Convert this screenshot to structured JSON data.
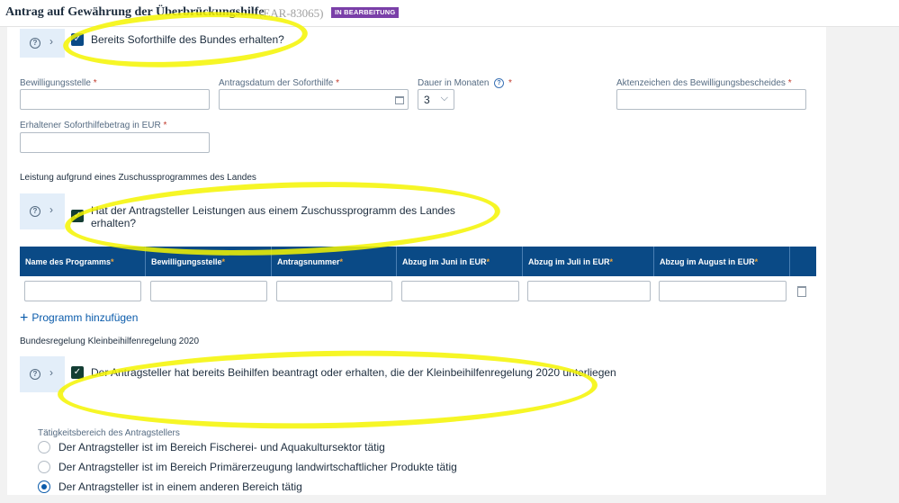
{
  "header": {
    "title": "Antrag auf Gewährung der Überbrückungshilfe",
    "id": "(EAR-83065)",
    "status_badge": "IN BEARBEITUNG"
  },
  "soforthilfe": {
    "checkbox_label": "Bereits Soforthilfe des Bundes erhalten?",
    "checked": true,
    "fields": {
      "bewilligungsstelle_label": "Bewilligungsstelle",
      "antragsdatum_label": "Antragsdatum der Soforthilfe",
      "dauer_label": "Dauer in Monaten",
      "dauer_value": "3",
      "aktenzeichen_label": "Aktenzeichen des Bewilligungsbescheides",
      "betrag_label": "Erhaltener Soforthilfebetrag in EUR",
      "required_marker": "*"
    }
  },
  "zuschuss": {
    "section_title": "Leistung aufgrund eines Zuschussprogrammes des Landes",
    "checkbox_label_line1": "Hat der Antragsteller Leistungen aus einem Zuschussprogramm des Landes",
    "checkbox_label_line2": "erhalten?",
    "checked": true,
    "table": {
      "columns": [
        "Name des Programms",
        "Bewilligungsstelle",
        "Antragsnummer",
        "Abzug im Juni in EUR",
        "Abzug im Juli in EUR",
        "Abzug im August in EUR"
      ],
      "required_marker": "*"
    },
    "add_row_label": "Programm hinzufügen"
  },
  "kleinbeihilfen": {
    "section_title": "Bundesregelung Kleinbeihilfenregelung 2020",
    "checkbox_label": "Der Antragsteller hat bereits Beihilfen beantragt oder erhalten, die der Kleinbeihilfenregelung 2020 unterliegen",
    "checked": true,
    "taetigkeit_label": "Tätigkeitsbereich des Antragstellers",
    "options": [
      "Der Antragsteller ist im Bereich Fischerei- und Aquakultursektor tätig",
      "Der Antragsteller ist im Bereich Primärerzeugung landwirtschaftlicher Produkte tätig",
      "Der Antragsteller ist in einem anderen Bereich tätig"
    ],
    "selected_option_index": 2
  },
  "icons": {
    "help": "?",
    "chevron_right": "›",
    "chevron_down": "⌵",
    "check": "✓",
    "plus": "+"
  },
  "colors": {
    "primary": "#0a4a86",
    "badge": "#7a3fa8",
    "highlight": "#f5f500",
    "required": "#c0392b"
  }
}
